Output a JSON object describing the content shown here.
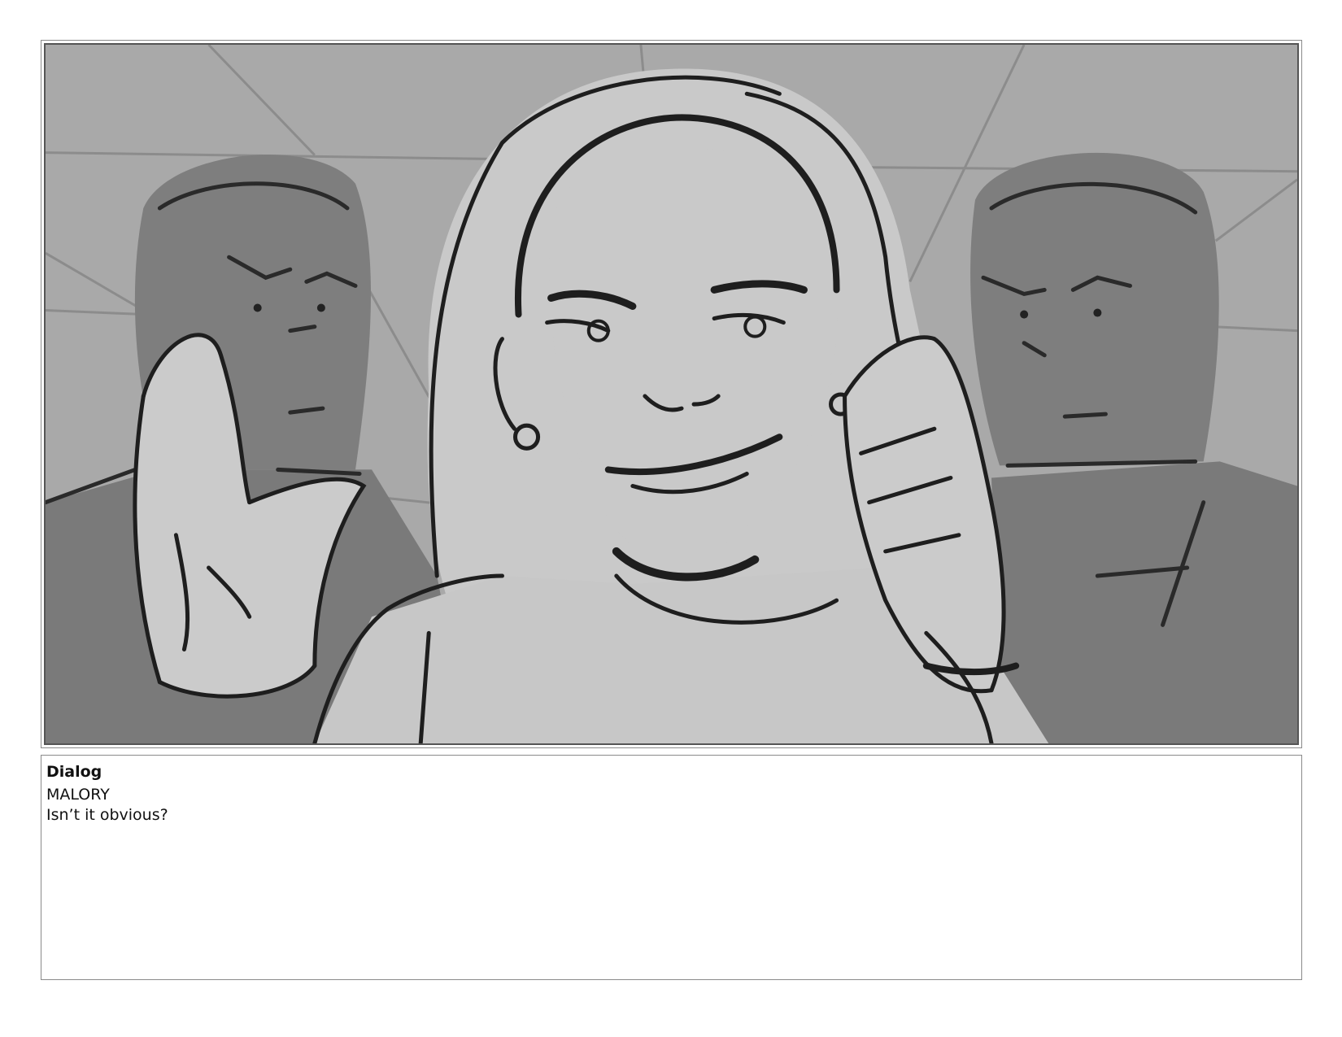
{
  "storyboard_panel": {
    "image_description_icon": "sketch-image"
  },
  "dialog": {
    "heading": "Dialog",
    "character": "MALORY",
    "line": "Isn’t it obvious?"
  }
}
